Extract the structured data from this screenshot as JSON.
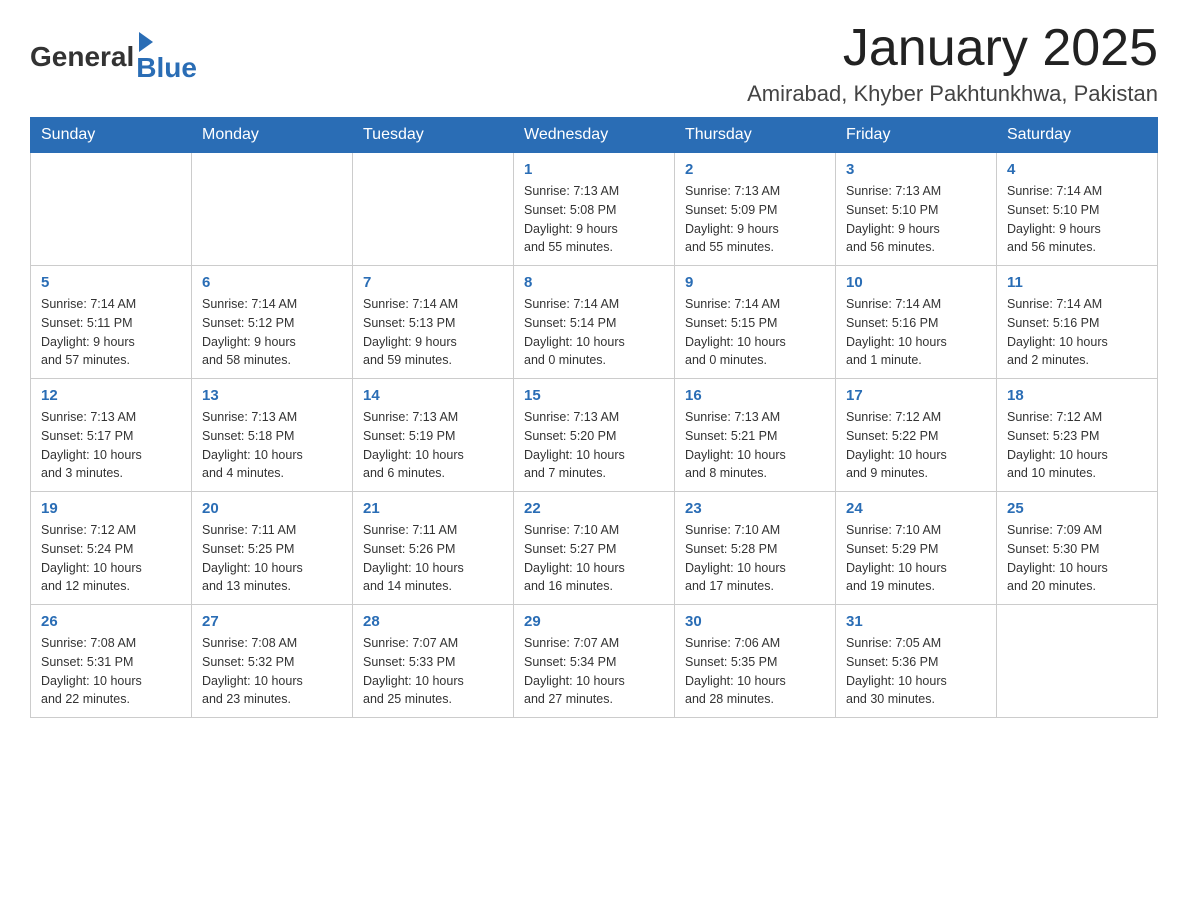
{
  "header": {
    "logo_general": "General",
    "logo_blue": "Blue",
    "title": "January 2025",
    "subtitle": "Amirabad, Khyber Pakhtunkhwa, Pakistan"
  },
  "weekdays": [
    "Sunday",
    "Monday",
    "Tuesday",
    "Wednesday",
    "Thursday",
    "Friday",
    "Saturday"
  ],
  "weeks": [
    [
      {
        "day": "",
        "info": ""
      },
      {
        "day": "",
        "info": ""
      },
      {
        "day": "",
        "info": ""
      },
      {
        "day": "1",
        "info": "Sunrise: 7:13 AM\nSunset: 5:08 PM\nDaylight: 9 hours\nand 55 minutes."
      },
      {
        "day": "2",
        "info": "Sunrise: 7:13 AM\nSunset: 5:09 PM\nDaylight: 9 hours\nand 55 minutes."
      },
      {
        "day": "3",
        "info": "Sunrise: 7:13 AM\nSunset: 5:10 PM\nDaylight: 9 hours\nand 56 minutes."
      },
      {
        "day": "4",
        "info": "Sunrise: 7:14 AM\nSunset: 5:10 PM\nDaylight: 9 hours\nand 56 minutes."
      }
    ],
    [
      {
        "day": "5",
        "info": "Sunrise: 7:14 AM\nSunset: 5:11 PM\nDaylight: 9 hours\nand 57 minutes."
      },
      {
        "day": "6",
        "info": "Sunrise: 7:14 AM\nSunset: 5:12 PM\nDaylight: 9 hours\nand 58 minutes."
      },
      {
        "day": "7",
        "info": "Sunrise: 7:14 AM\nSunset: 5:13 PM\nDaylight: 9 hours\nand 59 minutes."
      },
      {
        "day": "8",
        "info": "Sunrise: 7:14 AM\nSunset: 5:14 PM\nDaylight: 10 hours\nand 0 minutes."
      },
      {
        "day": "9",
        "info": "Sunrise: 7:14 AM\nSunset: 5:15 PM\nDaylight: 10 hours\nand 0 minutes."
      },
      {
        "day": "10",
        "info": "Sunrise: 7:14 AM\nSunset: 5:16 PM\nDaylight: 10 hours\nand 1 minute."
      },
      {
        "day": "11",
        "info": "Sunrise: 7:14 AM\nSunset: 5:16 PM\nDaylight: 10 hours\nand 2 minutes."
      }
    ],
    [
      {
        "day": "12",
        "info": "Sunrise: 7:13 AM\nSunset: 5:17 PM\nDaylight: 10 hours\nand 3 minutes."
      },
      {
        "day": "13",
        "info": "Sunrise: 7:13 AM\nSunset: 5:18 PM\nDaylight: 10 hours\nand 4 minutes."
      },
      {
        "day": "14",
        "info": "Sunrise: 7:13 AM\nSunset: 5:19 PM\nDaylight: 10 hours\nand 6 minutes."
      },
      {
        "day": "15",
        "info": "Sunrise: 7:13 AM\nSunset: 5:20 PM\nDaylight: 10 hours\nand 7 minutes."
      },
      {
        "day": "16",
        "info": "Sunrise: 7:13 AM\nSunset: 5:21 PM\nDaylight: 10 hours\nand 8 minutes."
      },
      {
        "day": "17",
        "info": "Sunrise: 7:12 AM\nSunset: 5:22 PM\nDaylight: 10 hours\nand 9 minutes."
      },
      {
        "day": "18",
        "info": "Sunrise: 7:12 AM\nSunset: 5:23 PM\nDaylight: 10 hours\nand 10 minutes."
      }
    ],
    [
      {
        "day": "19",
        "info": "Sunrise: 7:12 AM\nSunset: 5:24 PM\nDaylight: 10 hours\nand 12 minutes."
      },
      {
        "day": "20",
        "info": "Sunrise: 7:11 AM\nSunset: 5:25 PM\nDaylight: 10 hours\nand 13 minutes."
      },
      {
        "day": "21",
        "info": "Sunrise: 7:11 AM\nSunset: 5:26 PM\nDaylight: 10 hours\nand 14 minutes."
      },
      {
        "day": "22",
        "info": "Sunrise: 7:10 AM\nSunset: 5:27 PM\nDaylight: 10 hours\nand 16 minutes."
      },
      {
        "day": "23",
        "info": "Sunrise: 7:10 AM\nSunset: 5:28 PM\nDaylight: 10 hours\nand 17 minutes."
      },
      {
        "day": "24",
        "info": "Sunrise: 7:10 AM\nSunset: 5:29 PM\nDaylight: 10 hours\nand 19 minutes."
      },
      {
        "day": "25",
        "info": "Sunrise: 7:09 AM\nSunset: 5:30 PM\nDaylight: 10 hours\nand 20 minutes."
      }
    ],
    [
      {
        "day": "26",
        "info": "Sunrise: 7:08 AM\nSunset: 5:31 PM\nDaylight: 10 hours\nand 22 minutes."
      },
      {
        "day": "27",
        "info": "Sunrise: 7:08 AM\nSunset: 5:32 PM\nDaylight: 10 hours\nand 23 minutes."
      },
      {
        "day": "28",
        "info": "Sunrise: 7:07 AM\nSunset: 5:33 PM\nDaylight: 10 hours\nand 25 minutes."
      },
      {
        "day": "29",
        "info": "Sunrise: 7:07 AM\nSunset: 5:34 PM\nDaylight: 10 hours\nand 27 minutes."
      },
      {
        "day": "30",
        "info": "Sunrise: 7:06 AM\nSunset: 5:35 PM\nDaylight: 10 hours\nand 28 minutes."
      },
      {
        "day": "31",
        "info": "Sunrise: 7:05 AM\nSunset: 5:36 PM\nDaylight: 10 hours\nand 30 minutes."
      },
      {
        "day": "",
        "info": ""
      }
    ]
  ]
}
